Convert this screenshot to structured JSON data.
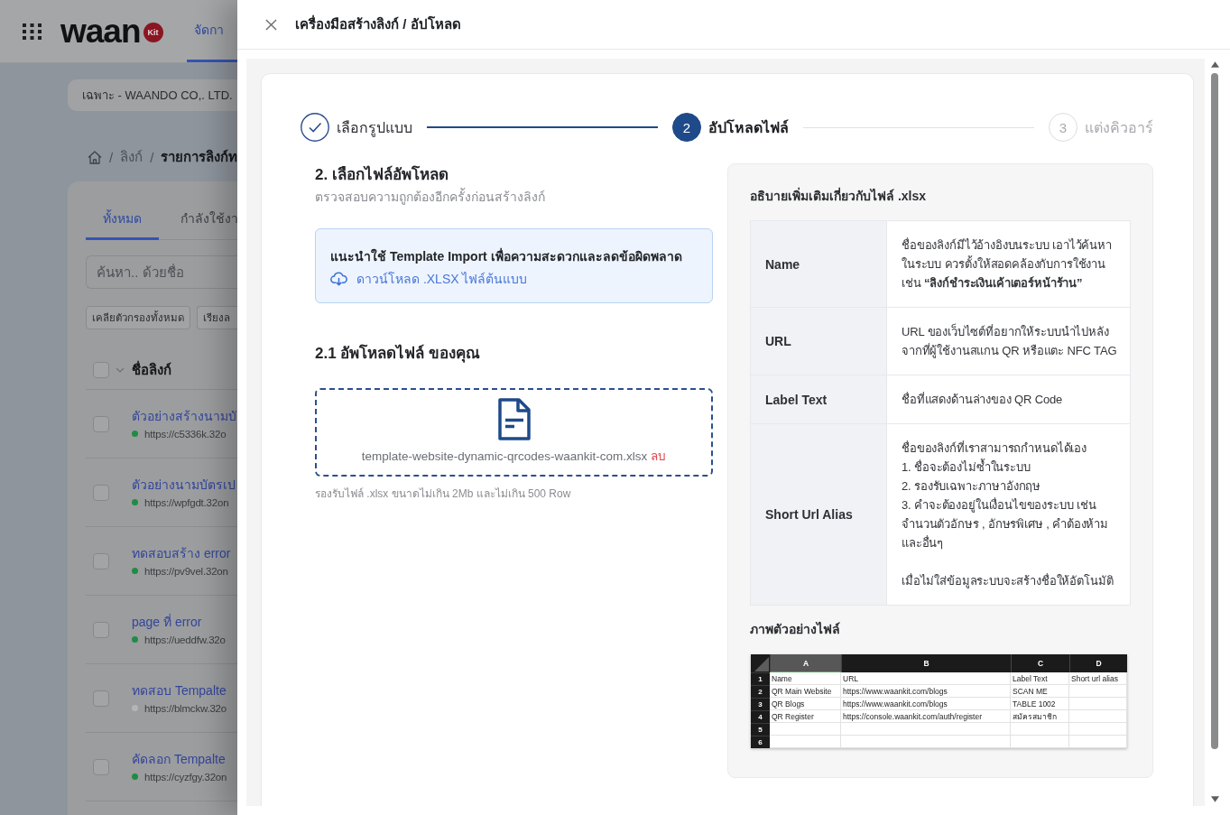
{
  "background_page": {
    "header": {
      "logo": {
        "wordmark": "waan",
        "badge": "Kit"
      },
      "nav_tabs": [
        {
          "label": "จัดกา",
          "selected": true
        }
      ]
    },
    "company_selector": {
      "value": "เฉพาะ - WAANDO CO,. LTD."
    },
    "breadcrumb": [
      {
        "kind": "home"
      },
      {
        "kind": "separator",
        "text": "/"
      },
      {
        "kind": "link",
        "text": "ลิงก์"
      },
      {
        "kind": "separator",
        "text": "/"
      },
      {
        "kind": "current",
        "text": "รายการลิงก์ท"
      }
    ],
    "tabs": [
      {
        "label": "ทั้งหมด",
        "selected": true
      },
      {
        "label": "กำลังใช้งา",
        "selected": false
      }
    ],
    "search": {
      "placeholder": "ค้นหา.. ด้วยชื่อ"
    },
    "filter_buttons": [
      "เคลียตัวกรองทั้งหมด",
      "เรียงล"
    ],
    "table": {
      "select_all_checked": false,
      "columns": [
        "ชื่อลิงก์"
      ],
      "rows": [
        {
          "title": "ตัวอย่างสร้างนามบั",
          "url": "https://c5336k.32o",
          "color": "#1f8c46",
          "checked": false
        },
        {
          "title": "ตัวอย่างนามบัตรเป",
          "url": "https://wpfgdt.32on",
          "color": "#1f8c46",
          "checked": false
        },
        {
          "title": "ทดสอบสร้าง error",
          "url": "https://pv9vel.32on",
          "color": "#1f8c46",
          "checked": false
        },
        {
          "title": "page ที่ error",
          "url": "https://ueddfw.32o",
          "color": "#1f8c46",
          "checked": false
        },
        {
          "title": "ทดสอบ Tempalte",
          "url": "https://blmckw.32o",
          "color": "#b3b5b8",
          "checked": false
        },
        {
          "title": "คัดลอก Tempalte",
          "url": "https://cyzfgy.32on",
          "color": "#1f8c46",
          "checked": false
        }
      ]
    }
  },
  "drawer": {
    "title": "เครื่องมือสร้างลิงก์ / อัปโหลด",
    "steps": [
      {
        "label": "เลือกรูปแบบ",
        "completed": true,
        "selected": false
      },
      {
        "number": "2",
        "label": "อัปโหลดไฟล์",
        "completed": false,
        "selected": true
      },
      {
        "number": "3",
        "label": "แต่งคิวอาร์",
        "completed": false,
        "selected": false
      }
    ],
    "upload_section": {
      "title": "2. เลือกไฟล์อัพโหลด",
      "subtitle": "ตรวจสอบความถูกต้องอีกครั้งก่อนสร้างลิงก์",
      "notice": {
        "text": "แนะนำใช้ Template Import เพื่อความสะดวกและลดข้อผิดพลาด",
        "link": "ดาวน์โหลด .XLSX ไฟล์ต้นแบบ"
      },
      "upload_title": "2.1 อัพโหลดไฟล์ ของคุณ",
      "file": {
        "name": "template-website-dynamic-qrcodes-waankit-com.xlsx",
        "remove": "ลบ"
      },
      "hint": "รองรับไฟล์ .xlsx ขนาดไม่เกิน 2Mb และไม่เกิน 500 Row"
    },
    "help_panel": {
      "title": "อธิบายเพิ่มเติมเกี่ยวกับไฟล์ .xlsx",
      "fields": [
        {
          "name": "Name",
          "description": "ชื่อของลิงก์มีไว้อ้างอิงบนระบบ เอาไว้ค้นหาในระบบ ควรตั้งให้สอดคล้องกับการใช้งาน เช่น **“ลิงก์ชำระเงินเค้าเตอร์หน้าร้าน”**"
        },
        {
          "name": "URL",
          "description": "URL ของเว็บไซต์ที่อยากให้ระบบนำไปหลังจากที่ผู้ใช้งานสแกน QR หรือแตะ NFC TAG"
        },
        {
          "name": "Label Text",
          "description": "ชื่อที่แสดงด้านล่างของ QR Code"
        },
        {
          "name": "Short Url Alias",
          "description": "ชื่อของลิงก์ที่เราสามารถกำหนดได้เอง\n1. ชื่อจะต้องไม่ซ้ำในระบบ\n2. รองรับเฉพาะภาษาอังกฤษ\n3. คำจะต้องอยู่ในเงื่อนไขของระบบ เช่น จำนวนตัวอักษร , อักษรพิเศษ , คำต้องห้าม และอื่นๆ\n\nเมื่อไม่ใส่ข้อมูลระบบจะสร้างชื่อให้อัตโนมัติ"
        }
      ],
      "example_title": "ภาพตัวอย่างไฟล์",
      "example_sheet": {
        "columns": [
          {
            "label": "A",
            "selected": true
          },
          {
            "label": "B",
            "selected": false
          },
          {
            "label": "C",
            "selected": false
          },
          {
            "label": "D",
            "selected": false
          }
        ],
        "rows": [
          {
            "number": "1",
            "cells": [
              "Name",
              "URL",
              "Label Text",
              "Short url alias"
            ]
          },
          {
            "number": "2",
            "cells": [
              "QR Main Website",
              "https://www.waankit.com/blogs",
              "SCAN ME"
            ]
          },
          {
            "number": "3",
            "cells": [
              "QR Blogs",
              "https://www.waankit.com/blogs",
              "TABLE 1002"
            ]
          },
          {
            "number": "4",
            "cells": [
              "QR Register",
              "https://console.waankit.com/auth/register",
              "สมัครสมาชิก"
            ]
          },
          {
            "number": "5",
            "cells": []
          },
          {
            "number": "6",
            "cells": []
          }
        ]
      }
    }
  }
}
